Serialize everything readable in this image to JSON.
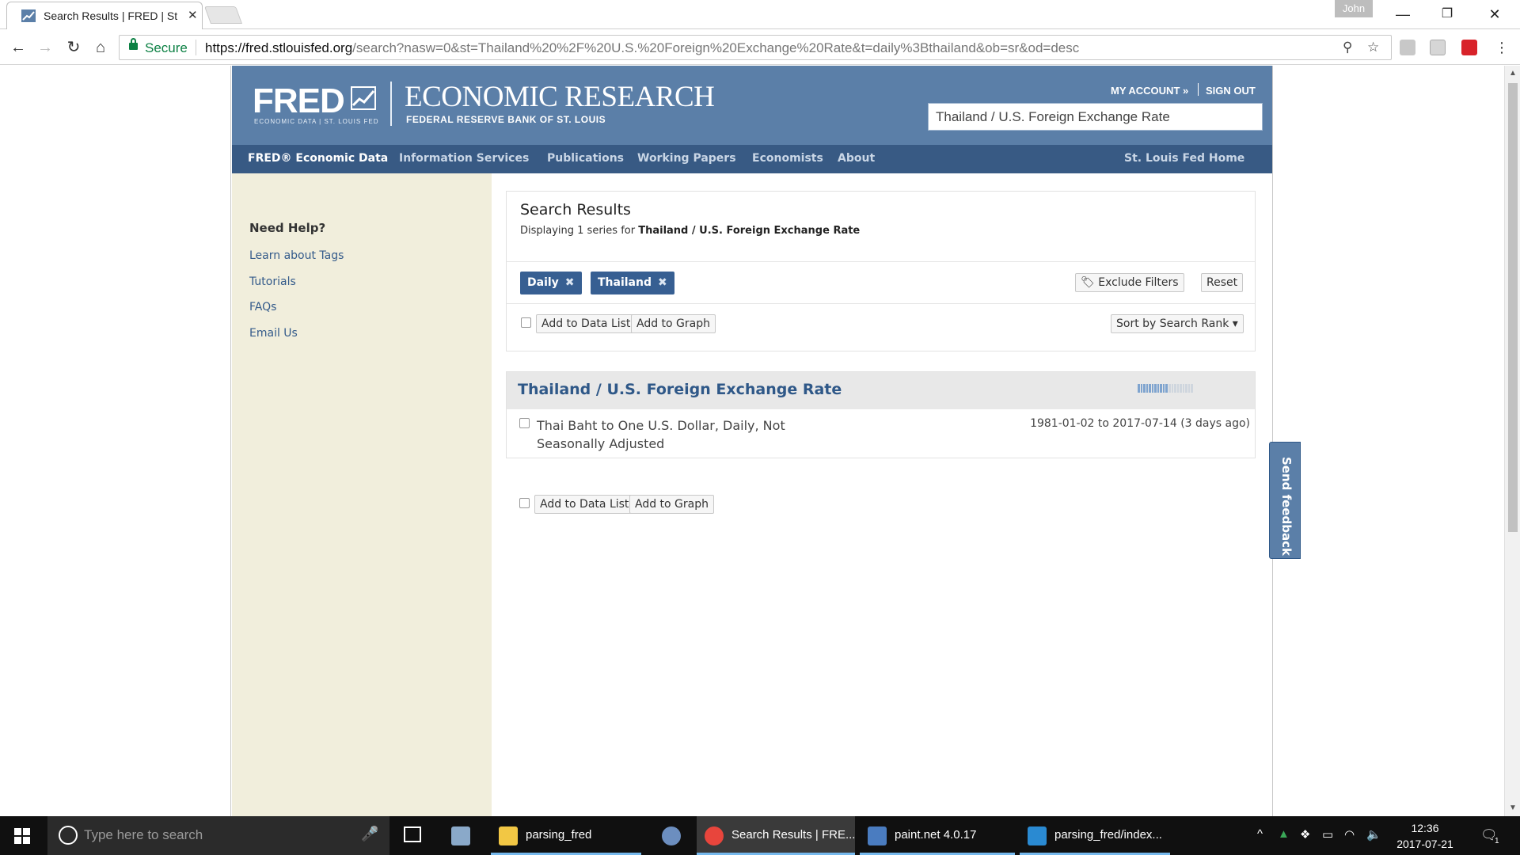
{
  "browser": {
    "tab_title": "Search Results | FRED | St",
    "profile_name": "John",
    "secure_label": "Secure",
    "url_host": "https://fred.stlouisfed.org",
    "url_path": "/search?nasw=0&st=Thailand%20%2F%20U.S.%20Foreign%20Exchange%20Rate&t=daily%3Bthailand&ob=sr&od=desc"
  },
  "header": {
    "logo_text": "FRED",
    "logo_subtext": "ECONOMIC DATA | ST. LOUIS FED",
    "site_title": "ECONOMIC RESEARCH",
    "site_subtitle": "FEDERAL RESERVE BANK OF ST. LOUIS",
    "my_account": "MY ACCOUNT",
    "sign_out": "SIGN OUT",
    "search_value": "Thailand / U.S. Foreign Exchange Rate"
  },
  "nav": {
    "items": [
      "FRED® Economic Data",
      "Information Services",
      "Publications",
      "Working Papers",
      "Economists",
      "About"
    ],
    "right": "St. Louis Fed Home"
  },
  "sidebar": {
    "title": "Need Help?",
    "links": [
      "Learn about Tags",
      "Tutorials",
      "FAQs",
      "Email Us"
    ]
  },
  "results": {
    "title": "Search Results",
    "displaying_prefix": "Displaying 1 series for",
    "query": "Thailand / U.S. Foreign Exchange Rate",
    "filters": [
      "Daily",
      "Thailand"
    ],
    "exclude_filters": "Exclude Filters",
    "reset": "Reset",
    "add_to_data_list": "Add to Data List",
    "add_to_graph": "Add to Graph",
    "sort_label": "Sort by Search Rank"
  },
  "series": {
    "title": "Thailand / U.S. Foreign Exchange Rate",
    "description": "Thai Baht to One U.S. Dollar, Daily, Not Seasonally Adjusted",
    "date_range": "1981-01-02 to 2017-07-14 (3 days ago)",
    "popularity_fraction": 0.55
  },
  "feedback": "Send feedback",
  "taskbar": {
    "search_placeholder": "Type here to search",
    "apps": [
      "parsing_fred",
      "Search Results | FRE...",
      "paint.net 4.0.17",
      "parsing_fred/index..."
    ],
    "time": "12:36",
    "date": "2017-07-21",
    "notification_count": "1"
  },
  "colors": {
    "header_bg": "#5b7fa8",
    "nav_bg": "#385a84",
    "sidebar_bg": "#f1eedc",
    "chip_bg": "#375f92",
    "link": "#2f5888"
  }
}
